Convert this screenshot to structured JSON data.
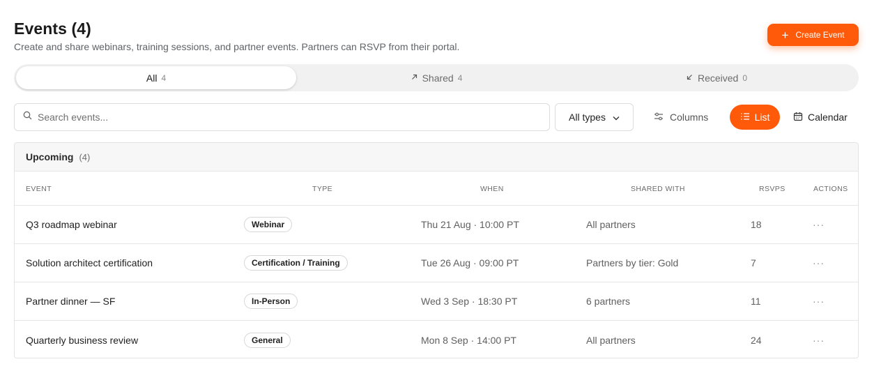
{
  "header": {
    "title": "Events (4)",
    "subtitle": "Create and share webinars, training sessions, and partner events. Partners can RSVP from their portal.",
    "create_label": "Create Event"
  },
  "tabs": [
    {
      "label": "All",
      "count": "4",
      "active": true
    },
    {
      "label": "Shared",
      "count": "4",
      "icon": "arrow-up-right-icon"
    },
    {
      "label": "Received",
      "count": "0",
      "icon": "arrow-down-left-icon"
    }
  ],
  "toolbar": {
    "search_placeholder": "Search events...",
    "type_filter": "All types",
    "columns_label": "Columns",
    "list_label": "List",
    "calendar_label": "Calendar"
  },
  "section": {
    "title": "Upcoming",
    "count": "(4)"
  },
  "columns": {
    "event": "Event",
    "type": "Type",
    "when": "When",
    "shared_with": "Shared With",
    "rsvps": "RSVPs",
    "actions": "Actions"
  },
  "rows": [
    {
      "name": "Q3 roadmap webinar",
      "type": "Webinar",
      "when": "Thu 21 Aug · 10:00 PT",
      "shared": "All partners",
      "rsvps": "18",
      "actions": "···"
    },
    {
      "name": "Solution architect certification",
      "type": "Certification / Training",
      "when": "Tue 26 Aug · 09:00 PT",
      "shared": "Partners by tier: Gold",
      "rsvps": "7",
      "actions": "···"
    },
    {
      "name": "Partner dinner — SF",
      "type": "In-Person",
      "when": "Wed 3 Sep · 18:30 PT",
      "shared": "6 partners",
      "rsvps": "11",
      "actions": "···"
    },
    {
      "name": "Quarterly business review",
      "type": "General",
      "when": "Mon 8 Sep · 14:00 PT",
      "shared": "All partners",
      "rsvps": "24",
      "actions": "···"
    }
  ],
  "colors": {
    "accent": "#ff5a0a",
    "border": "#e3e3e3",
    "muted_text": "#5f6368"
  }
}
